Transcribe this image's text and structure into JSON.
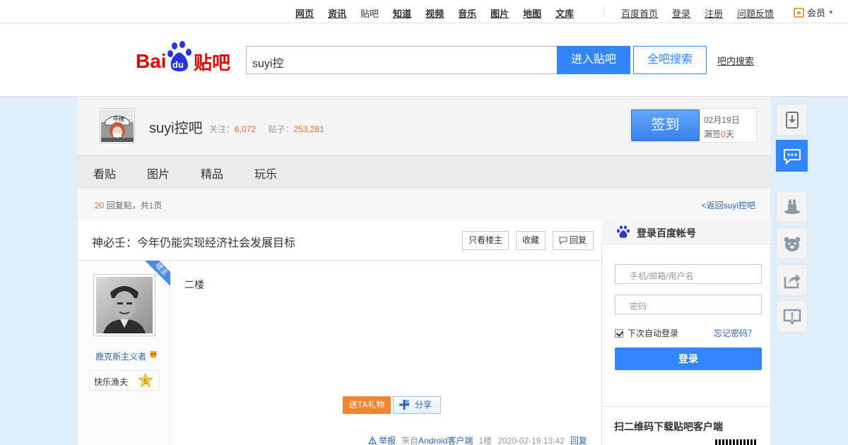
{
  "topnav": {
    "items": [
      "网页",
      "资讯",
      "贴吧",
      "知道",
      "视频",
      "音乐",
      "图片",
      "地图",
      "文库"
    ],
    "right": [
      "百度首页",
      "登录",
      "注册",
      "问题反馈"
    ],
    "vip": "会员"
  },
  "header": {
    "search_value": "suyi控",
    "enter_label": "进入贴吧",
    "all_label": "全吧搜索",
    "inbar_label": "吧内搜索"
  },
  "forum": {
    "name": "suyi控吧",
    "follow_label": "关注：",
    "follow_count": "6,072",
    "posts_label": "贴子：",
    "posts_count": "253,281",
    "sign_label": "签到",
    "sign_date": "02月19日",
    "miss_prefix": "漏签",
    "miss_days": "0",
    "miss_suffix": "天"
  },
  "tabs": [
    "看贴",
    "图片",
    "精品",
    "玩乐"
  ],
  "info": {
    "reply_count": "20",
    "reply_text": " 回复贴，共",
    "pages": "1",
    "pages_suffix": "页",
    "back_link": "<返回suyi控吧"
  },
  "post": {
    "title": "神必壬：今年仍能实现经济社会发展目标",
    "only_op": "只看楼主",
    "favorite": "收藏",
    "reply": "回复",
    "op_badge": "楼主",
    "username": "鹿克斯主义者",
    "level_name": "快乐渔夫",
    "level": "5",
    "content": "二楼",
    "gift": "送TA礼物",
    "share": "分享",
    "report": "举报",
    "from_prefix": "来自",
    "client": "Android客户端",
    "floor": "1楼",
    "time": "2020-02-19 13:42",
    "reply_link": "回复"
  },
  "login": {
    "title": "登录百度帐号",
    "user_placeholder": "手机/邮箱/用户名",
    "pass_placeholder": "密码",
    "remember": "下次自动登录",
    "forgot": "忘记密码？",
    "login_button": "登录",
    "qr_title": "扫二维码下载贴吧客户端"
  },
  "colors": {
    "accent": "#3385ff",
    "orange": "#f0652f",
    "link": "#2d64b3"
  },
  "right_float_icons": [
    "download-icon",
    "message-icon",
    "magic-hat-icon",
    "bear-icon",
    "share-icon",
    "report-icon"
  ]
}
